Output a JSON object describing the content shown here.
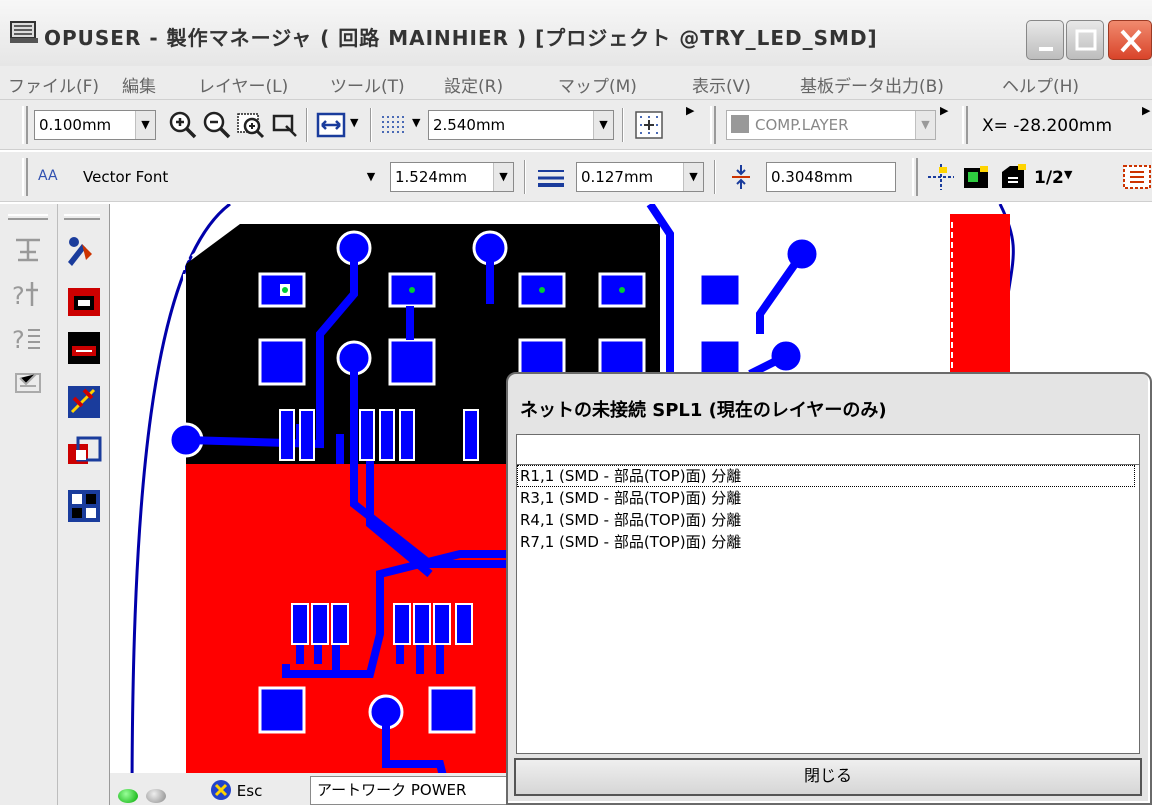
{
  "window": {
    "title": "OPUSER - 製作マネージャ ( 回路 MAINHIER ) [プロジェクト @TRY_LED_SMD]"
  },
  "menu": [
    "ファイル(F)",
    "編集",
    "レイヤー(L)",
    "ツール(T)",
    "設定(R)",
    "マップ(M)",
    "表示(V)",
    "基板データ出力(B)",
    "ヘルプ(H)"
  ],
  "toolbar1": {
    "zoom_step": "0.100mm",
    "grid_size": "2.540mm",
    "layer": "COMP.LAYER",
    "coord_x": "X= -28.200mm"
  },
  "toolbar2": {
    "font_prefix": "AA",
    "font": "Vector Font",
    "text_size": "1.524mm",
    "line_width": "0.127mm",
    "clearance": "0.3048mm",
    "half_label": "1/2"
  },
  "status": {
    "esc_label": "Esc",
    "mode": "アートワーク POWER"
  },
  "dialog": {
    "title": "ネットの未接続 SPL1 (現在のレイヤーのみ)",
    "filter": "",
    "items": [
      "R1,1 (SMD - 部品(TOP)面) 分離",
      "R3,1 (SMD - 部品(TOP)面) 分離",
      "R4,1 (SMD - 部品(TOP)面) 分離",
      "R7,1 (SMD - 部品(TOP)面) 分離"
    ],
    "close_label": "閉じる"
  },
  "colors": {
    "copper_top": "#0000ff",
    "copper_fill_red": "#ff0000",
    "copper_fill_black": "#000000",
    "outline": "#0000aa",
    "via_center": "#00cc33"
  }
}
